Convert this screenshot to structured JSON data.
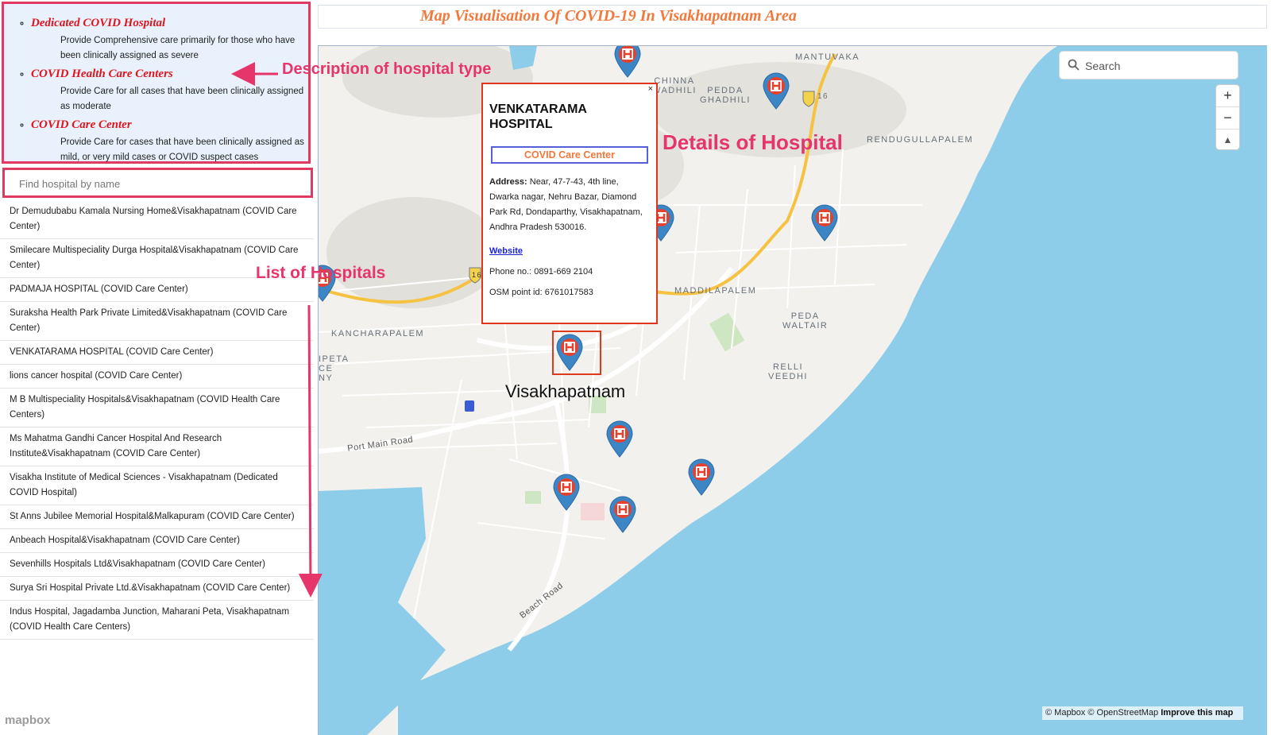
{
  "page_title": "Map Visualisation Of COVID-19 In Visakhapatnam Area",
  "hospital_types": [
    {
      "name": "Dedicated COVID Hospital",
      "description": "Provide Comprehensive care primarily for those who have been clinically assigned as severe"
    },
    {
      "name": "COVID Health Care Centers",
      "description": "Provide Care for all cases that have been clinically assigned as moderate"
    },
    {
      "name": "COVID Care Center",
      "description": "Provide Care for cases that have been clinically assigned as mild, or very mild cases or COVID suspect cases"
    }
  ],
  "hospital_search": {
    "placeholder": "Find hospital by name"
  },
  "hospitals": [
    "Dr Demudubabu Kamala Nursing Home&Visakhapatnam (COVID Care Center)",
    "Smilecare Multispeciality Durga Hospital&Visakhapatnam (COVID Care Center)",
    "PADMAJA HOSPITAL (COVID Care Center)",
    "Suraksha Health Park Private Limited&Visakhapatnam (COVID Care Center)",
    "VENKATARAMA HOSPITAL (COVID Care Center)",
    "lions cancer hospital (COVID Care Center)",
    "M B Multispeciality Hospitals&Visakhapatnam (COVID Health Care Centers)",
    "Ms Mahatma Gandhi Cancer Hospital And Research Institute&Visakhapatnam (COVID Care Center)",
    "Visakha Institute of Medical Sciences - Visakhapatnam (Dedicated COVID Hospital)",
    "St Anns Jubilee Memorial Hospital&Malkapuram (COVID Care Center)",
    "Anbeach Hospital&Visakhapatnam (COVID Care Center)",
    "Sevenhills Hospitals Ltd&Visakhapatnam (COVID Care Center)",
    "Surya Sri Hospital Private Ltd.&Visakhapatnam (COVID Care Center)",
    "Indus Hospital, Jagadamba Junction, Maharani Peta, Visakhapatnam (COVID Health Care Centers)"
  ],
  "popup": {
    "name": "VENKATARAMA HOSPITAL",
    "type": "COVID Care Center",
    "address_label": "Address:",
    "address": "Near, 47-7-43, 4th line, Dwarka nagar, Nehru Bazar, Diamond Park Rd, Dondaparthy, Visakhapatnam, Andhra Pradesh 530016.",
    "website_label": "Website",
    "phone": "Phone no.: 0891-669 2104",
    "osm": "OSM point id: 6761017583",
    "close": "×"
  },
  "map": {
    "search_placeholder": "Search",
    "zoom_in": "+",
    "zoom_out": "−",
    "compass": "▲",
    "city": "Visakhapatnam",
    "place_labels": [
      "MANTUVAKA",
      "CHINNA\nWADHILI",
      "PEDDA\nGHADHILI",
      "RENDUGULLAPALEM",
      "MADDILAPALEM",
      "PEDA\nWALTAIR",
      "RELLI\nVEEDHI",
      "KANCHARAPALEM",
      "IPETA\nCE\nNY"
    ],
    "road_labels": [
      "Port Main Road",
      "Beach Road"
    ],
    "highway_shield": "16",
    "attribution": "© Mapbox © OpenStreetMap",
    "improve": "Improve this map",
    "logo": "mapbox",
    "colors": {
      "water": "#8ecdea",
      "land": "#f2f1ed",
      "marker": "#3c86c6",
      "highway": "#f5c242"
    }
  },
  "annotations": {
    "hospital_type": "Description of hospital type",
    "details": "Details of Hospital",
    "list": "List of Hospitals"
  }
}
